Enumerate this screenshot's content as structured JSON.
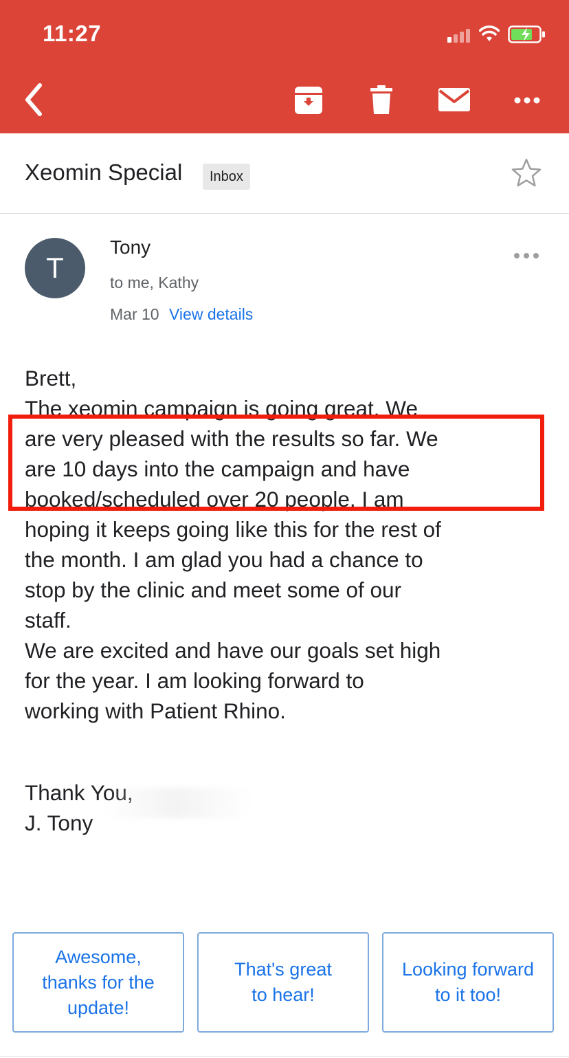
{
  "status_bar": {
    "time": "11:27"
  },
  "toolbar": {
    "back_icon": "chevron-left-icon",
    "archive_icon": "archive-icon",
    "delete_icon": "trash-icon",
    "mark_unread_icon": "mail-icon",
    "more_icon": "more-horizontal-icon"
  },
  "email": {
    "subject": "Xeomin Special",
    "label": "Inbox",
    "sender_initial": "T",
    "sender_name": "Tony",
    "recipients": "to me, Kathy",
    "date": "Mar 10",
    "view_details": "View details",
    "body_lines": [
      "Brett,",
      "The xeomin campaign is going great.  We",
      "are very pleased with the results so far.  We",
      "are 10 days into the campaign and have",
      "booked/scheduled over 20 people.  I am",
      "hoping it keeps going like this for the rest of",
      "the month.  I am glad you had a chance to",
      "stop by the clinic and meet some of our",
      "staff.",
      "We are excited and have our goals set high",
      "for the year.  I am looking forward to",
      "working with Patient Rhino.",
      "",
      "Thank You,",
      "J. Tony"
    ]
  },
  "smart_replies": [
    {
      "label": "Awesome, thanks for the update!"
    },
    {
      "label": "That's great to hear!"
    },
    {
      "label": "Looking forward to it too!"
    }
  ],
  "colors": {
    "header_red": "#db4437",
    "link_blue": "#1a73e8",
    "highlight_red": "#f21d0c",
    "avatar": "#4b5b6b"
  }
}
